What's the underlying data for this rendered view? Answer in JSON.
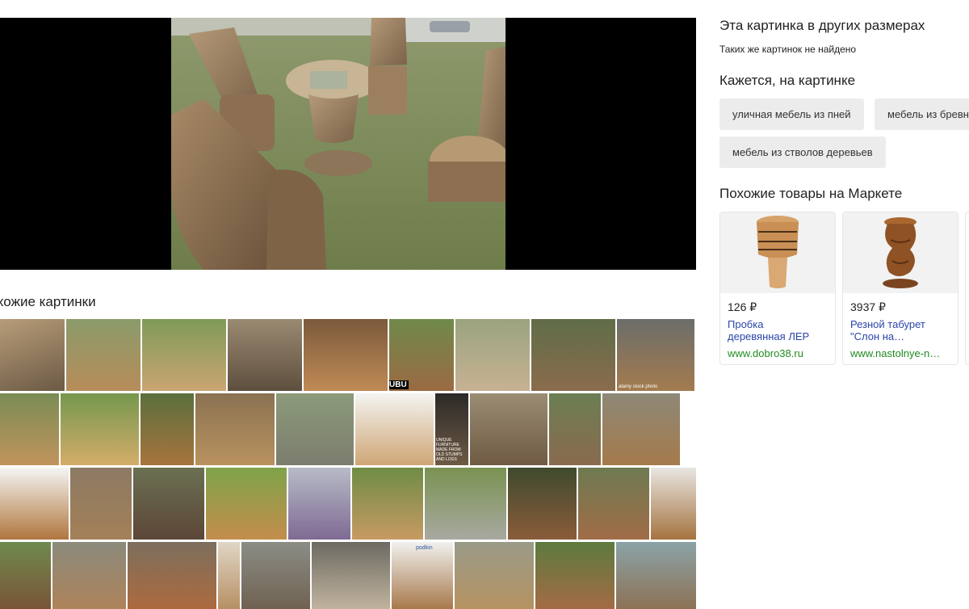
{
  "right": {
    "sizes_title": "Эта картинка в других размерах",
    "sizes_note": "Таких же картинок не найдено",
    "tags_title": "Кажется, на картинке",
    "tags": [
      "уличная мебель из пней",
      "мебель из бревн",
      "мебель из стволов деревьев"
    ],
    "market_title": "Похожие товары на Маркете",
    "products": [
      {
        "price": "126 ₽",
        "title_line1": "Пробка",
        "title_line2": "деревянная ЛЕР",
        "host": "www.dobro38.ru"
      },
      {
        "price": "3937 ₽",
        "title_line1": "Резной табурет",
        "title_line2": "\"Слон на…",
        "host": "www.nastolnye-n…"
      }
    ]
  },
  "main": {
    "similar_title": "хожие картинки"
  },
  "overlay_text": {
    "thumb_watermark": "UBU",
    "thumb_caption": "UNIQUE FURNITURE MADE FROM OLD STUMPS AND LOGS",
    "thumb_alamy": "alamy stock photo",
    "thumb_brand": "podkin"
  },
  "colors": {
    "preview_bg": "#000000",
    "chip_bg": "#ececec",
    "link_blue": "#2a45a8",
    "host_green": "#218a21"
  }
}
